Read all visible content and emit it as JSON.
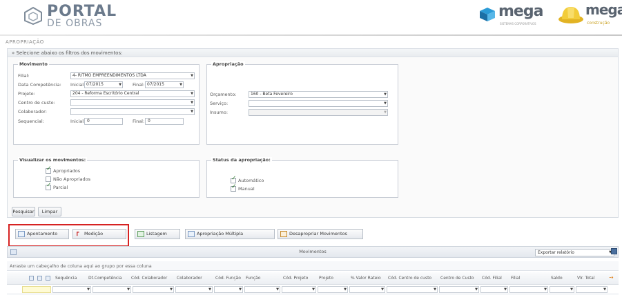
{
  "header": {
    "logo_title": "PORTAL",
    "logo_subtitle": "DE OBRAS",
    "brand1": "mega",
    "brand1_sub": "SISTEMAS CORPORATIVOS",
    "brand2": "mega",
    "brand2_sub": "construção"
  },
  "page_title": "APROPRIAÇÃO",
  "filters": {
    "heading": "» Selecione abaixo os filtros dos movimentos:",
    "movimento": {
      "legend": "Movimento",
      "filial_label": "Filial:",
      "filial_value": "4- RITMO EMPREENDIMENTOS LTDA",
      "competencia_label": "Data Competência:",
      "inicial_label": "Inicial:",
      "inicial_value": "07/2015",
      "final_label": "Final:",
      "final_value": "07/2015",
      "projeto_label": "Projeto:",
      "projeto_value": "204 - Reforma Escritório Central",
      "centro_label": "Centro de custo:",
      "colaborador_label": "Colaborador:",
      "sequencial_label": "Sequencial:",
      "seq_inicial_label": "Inicial:",
      "seq_inicial_value": "0",
      "seq_final_label": "Final:",
      "seq_final_value": "0"
    },
    "apropriacao": {
      "legend": "Apropriação",
      "orcamento_label": "Orçamento:",
      "orcamento_value": "160 - Beta Fevereiro",
      "servico_label": "Serviço:",
      "insumo_label": "Insumo:"
    },
    "visualizar": {
      "legend": "Visualizar os movimentos:",
      "items": [
        {
          "label": "Apropriados",
          "checked": true
        },
        {
          "label": "Não Apropriados",
          "checked": false
        },
        {
          "label": "Parcial",
          "checked": true
        }
      ]
    },
    "status": {
      "legend": "Status da apropriação:",
      "items": [
        {
          "label": "Automático",
          "checked": true
        },
        {
          "label": "Manual",
          "checked": true
        }
      ]
    },
    "pesquisar": "Pesquisar",
    "limpar": "Limpar"
  },
  "actions": {
    "apontamento": "Apontamento",
    "medicao": "Medição",
    "listagem": "Listagem",
    "apropriacao_multipla": "Apropriação Múltipla",
    "desapropriar": "Desapropriar Movimentos"
  },
  "grid": {
    "title": "Movimentos",
    "export_label": "Exportar relatório",
    "group_hint": "Arraste um cabeçalho de coluna aqui ao grupo por essa coluna",
    "columns": [
      "Sequência",
      "Dt.Competência",
      "Cód. Colaborador",
      "Colaborador",
      "Cód. Função",
      "Função",
      "Cód. Projeto",
      "Projeto",
      "% Valor Rateio",
      "Cód. Centro de custo",
      "Centro de Custo",
      "Cód. Filial",
      "Filial",
      "Saldo",
      "Vlr. Total"
    ]
  }
}
